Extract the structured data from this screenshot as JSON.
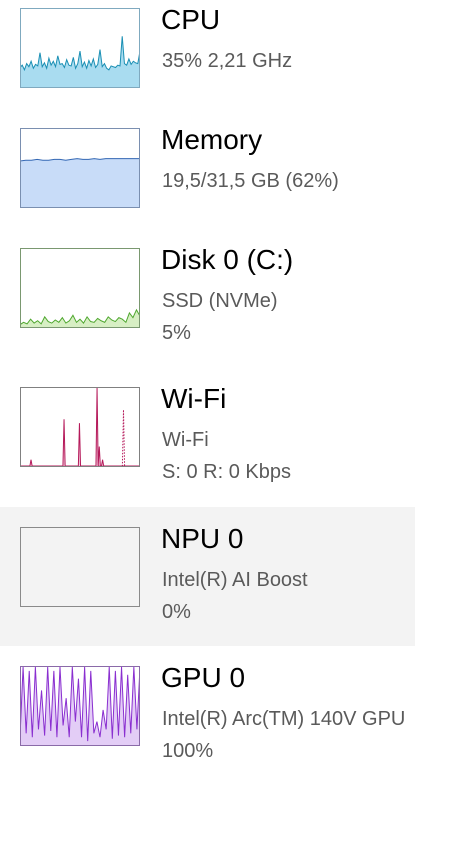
{
  "items": [
    {
      "key": "cpu",
      "title": "CPU",
      "line1": "35%  2,21 GHz",
      "line2": "",
      "selected": false,
      "usage_history": [
        0.25,
        0.28,
        0.22,
        0.3,
        0.26,
        0.33,
        0.24,
        0.29,
        0.27,
        0.44,
        0.26,
        0.31,
        0.24,
        0.37,
        0.28,
        0.33,
        0.26,
        0.4,
        0.29,
        0.3,
        0.25,
        0.35,
        0.28,
        0.27,
        0.38,
        0.24,
        0.3,
        0.46,
        0.26,
        0.32,
        0.24,
        0.34,
        0.27,
        0.36,
        0.25,
        0.29,
        0.48,
        0.26,
        0.3,
        0.24,
        0.22,
        0.27,
        0.26,
        0.25,
        0.28,
        0.27,
        0.65,
        0.3,
        0.28,
        0.36,
        0.29,
        0.33,
        0.31,
        0.3,
        0.46
      ],
      "colors": {
        "line": "#1a8fb4",
        "fill": "#a9dcf0",
        "border": "#7fa9bf"
      }
    },
    {
      "key": "memory",
      "title": "Memory",
      "line1": "19,5/31,5 GB (62%)",
      "line2": "",
      "selected": false,
      "usage_history": [
        0.59,
        0.6,
        0.6,
        0.61,
        0.6,
        0.6,
        0.61,
        0.61,
        0.6,
        0.61,
        0.62,
        0.61,
        0.61,
        0.62,
        0.61,
        0.62,
        0.62,
        0.62,
        0.62,
        0.62,
        0.62,
        0.62
      ],
      "colors": {
        "line": "#3468b4",
        "fill": "#c8dcf8",
        "border": "#7a8fb0"
      }
    },
    {
      "key": "disk",
      "title": "Disk 0 (C:)",
      "line1": "SSD (NVMe)",
      "line2": "5%",
      "selected": false,
      "usage_history": [
        0.03,
        0.06,
        0.04,
        0.1,
        0.05,
        0.08,
        0.04,
        0.13,
        0.07,
        0.05,
        0.09,
        0.06,
        0.12,
        0.05,
        0.08,
        0.15,
        0.06,
        0.1,
        0.05,
        0.13,
        0.07,
        0.06,
        0.11,
        0.08,
        0.06,
        0.13,
        0.09,
        0.07,
        0.12,
        0.1,
        0.06,
        0.18,
        0.12,
        0.22,
        0.14
      ],
      "colors": {
        "line": "#4fa82f",
        "fill": "#d7efc4",
        "border": "#7a9870"
      }
    },
    {
      "key": "wifi",
      "title": "Wi-Fi",
      "line1": "Wi-Fi",
      "line2": "S: 0  R: 0 Kbps",
      "selected": false,
      "usage_history": [
        0,
        0,
        0,
        0,
        0,
        0,
        0,
        0,
        0,
        0,
        0.08,
        0,
        0,
        0,
        0,
        0,
        0,
        0,
        0,
        0,
        0,
        0,
        0,
        0,
        0,
        0,
        0,
        0,
        0,
        0,
        0,
        0,
        0,
        0,
        0,
        0,
        0,
        0,
        0,
        0,
        0.6,
        0,
        0,
        0,
        0,
        0,
        0,
        0,
        0,
        0,
        0,
        0,
        0,
        0,
        0.55,
        0,
        0,
        0,
        0,
        0,
        0,
        0,
        0,
        0,
        0,
        0,
        0,
        0,
        0,
        0,
        1.0,
        0,
        0.25,
        0,
        0,
        0.08,
        0,
        0,
        0,
        0,
        0,
        0,
        0,
        0,
        0,
        0,
        0,
        0,
        0,
        0,
        0,
        0,
        0,
        0,
        0,
        0,
        0,
        0,
        0,
        0,
        0,
        0,
        0,
        0,
        0,
        0,
        0,
        0,
        0,
        0
      ],
      "secondary_history": [
        0,
        0,
        0,
        0,
        0,
        0,
        0,
        0,
        0,
        0,
        0,
        0,
        0,
        0,
        0,
        0,
        0,
        0,
        0,
        0,
        0,
        0,
        0,
        0,
        0,
        0,
        0,
        0,
        0,
        0,
        0,
        0,
        0,
        0,
        0,
        0,
        0,
        0,
        0,
        0,
        0,
        0,
        0,
        0,
        0,
        0,
        0,
        0,
        0,
        0,
        0,
        0,
        0,
        0,
        0,
        0,
        0,
        0,
        0,
        0,
        0,
        0,
        0,
        0,
        0,
        0,
        0,
        0,
        0,
        0,
        0,
        0,
        0,
        0,
        0,
        0,
        0,
        0,
        0,
        0,
        0,
        0,
        0,
        0,
        0,
        0,
        0,
        0,
        0,
        0,
        0,
        0,
        0,
        0,
        0.72,
        0,
        0,
        0,
        0,
        0,
        0,
        0,
        0,
        0,
        0,
        0,
        0,
        0,
        0,
        0
      ],
      "colors": {
        "line": "#b5195a",
        "fill": "#f2c6d8",
        "border": "#808080"
      }
    },
    {
      "key": "npu",
      "title": "NPU 0",
      "line1": "Intel(R) AI Boost",
      "line2": "0%",
      "selected": true,
      "usage_history": [],
      "colors": {
        "line": "#3a6ec2",
        "fill": "#dce8fa",
        "border": "#8a8a8a"
      }
    },
    {
      "key": "gpu",
      "title": "GPU 0",
      "line1": "Intel(R) Arc(TM) 140V GPU",
      "line2": "100%",
      "selected": false,
      "usage_history": [
        0.1,
        1.0,
        0.15,
        0.95,
        0.1,
        1.0,
        0.2,
        0.7,
        0.12,
        1.0,
        0.18,
        0.95,
        0.1,
        1.0,
        0.25,
        0.6,
        0.1,
        1.0,
        0.3,
        0.85,
        0.1,
        1.0,
        0.05,
        0.95,
        0.15,
        0.3,
        0.1,
        0.45,
        0.2,
        1.0,
        0.08,
        0.95,
        0.12,
        1.0,
        0.1,
        0.9,
        0.15,
        1.0,
        0.2,
        1.0
      ],
      "colors": {
        "line": "#8a2fd0",
        "fill": "#e3cdf6",
        "border": "#8a6aa8"
      }
    }
  ]
}
